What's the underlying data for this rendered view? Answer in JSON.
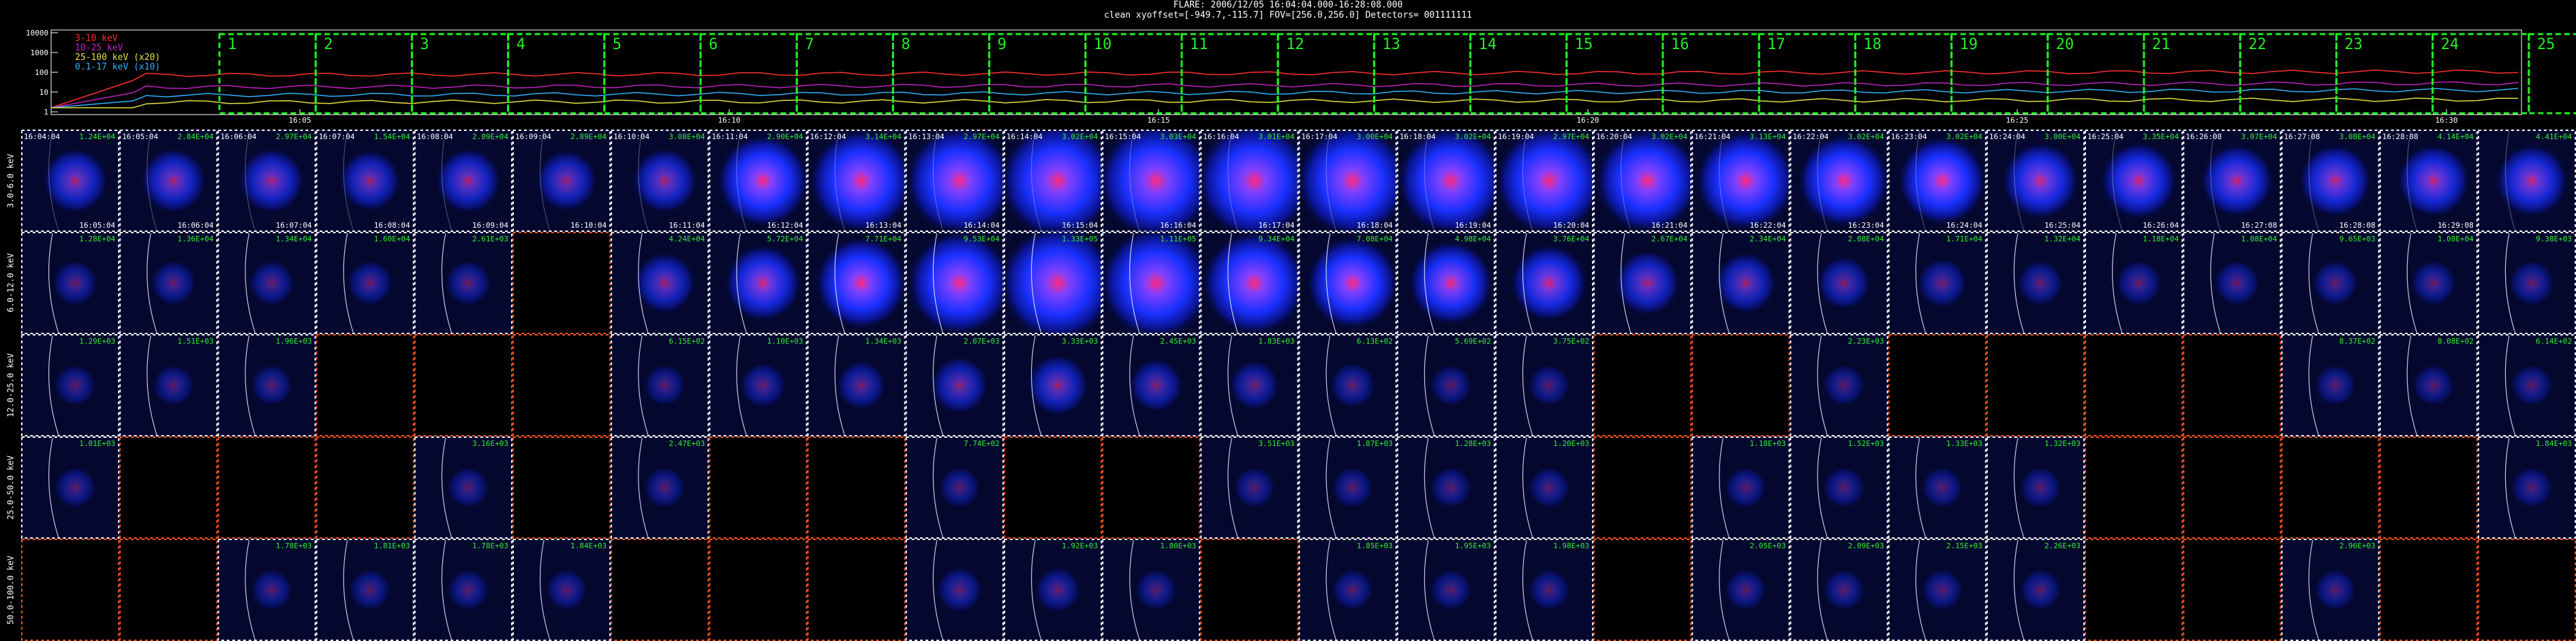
{
  "header": {
    "line1": "FLARE: 2006/12/05 16:04:04.000-16:28:08.000",
    "line2": "clean    xyoffset=[-949.7,-115.7]    FOV=[256.0,256.0]    Detectors= 001111111"
  },
  "lightcurve": {
    "y_ticks": [
      "10000",
      "1000",
      "100",
      "10",
      "1"
    ],
    "x_ticks": [
      "16:05",
      "16:10",
      "16:15",
      "16:20",
      "16:25",
      "16:30"
    ],
    "legend": [
      {
        "label": "3-10 keV",
        "color": "#ff3030"
      },
      {
        "label": "10-25 keV",
        "color": "#c020c0"
      },
      {
        "label": "25-100 keV (x20)",
        "color": "#e0e040"
      },
      {
        "label": "0.1-17 keV (x10)",
        "color": "#30b0ff"
      }
    ],
    "intervals": [
      "1",
      "2",
      "3",
      "4",
      "5",
      "6",
      "7",
      "8",
      "9",
      "10",
      "11",
      "12",
      "13",
      "14",
      "15",
      "16",
      "17",
      "18",
      "19",
      "20",
      "21",
      "22",
      "23",
      "24",
      "25"
    ],
    "colors": {
      "box": "#22ee22",
      "grid_ok": "#ffffff",
      "grid_bad": "#ff5522"
    }
  },
  "grid": {
    "rows": [
      {
        "energy": "3.0-6.0 keV",
        "labels": [
          "1.24E+04",
          "2.84E+04",
          "2.97E+04",
          "1.54E+04",
          "2.09E+04",
          "2.89E+04",
          "3.08E+04",
          "2.90E+04",
          "3.14E+04",
          "2.97E+04",
          "3.02E+04",
          "3.03E+04",
          "3.01E+04",
          "3.00E+04",
          "3.02E+04",
          "2.97E+04",
          "3.02E+04",
          "3.13E+04",
          "3.02E+04",
          "3.02E+04",
          "3.00E+04",
          "3.35E+04",
          "3.07E+04",
          "3.08E+04",
          "4.14E+04",
          "4.41E+04"
        ],
        "start_times": [
          "16:04:04",
          "16:05:04",
          "16:06:04",
          "16:07:04",
          "16:08:04",
          "16:09:04",
          "16:10:04",
          "16:11:04",
          "16:12:04",
          "16:13:04",
          "16:14:04",
          "16:15:04",
          "16:16:04",
          "16:17:04",
          "16:18:04",
          "16:19:04",
          "16:20:04",
          "16:21:04",
          "16:22:04",
          "16:23:04",
          "16:24:04",
          "16:25:04",
          "16:26:08",
          "16:27:08",
          "16:28:08"
        ],
        "end_times": [
          "16:05:04",
          "16:06:04",
          "16:07:04",
          "16:08:04",
          "16:09:04",
          "16:10:04",
          "16:11:04",
          "16:12:04",
          "16:13:04",
          "16:14:04",
          "16:15:04",
          "16:16:04",
          "16:17:04",
          "16:18:04",
          "16:19:04",
          "16:20:04",
          "16:21:04",
          "16:22:04",
          "16:23:04",
          "16:24:04",
          "16:25:04",
          "16:26:04",
          "16:27:08",
          "16:28:08",
          "16:29:08"
        ],
        "missing": [],
        "intensity": [
          0.35,
          0.35,
          0.35,
          0.3,
          0.35,
          0.3,
          0.35,
          0.7,
          0.85,
          0.9,
          1.0,
          1.0,
          1.0,
          0.95,
          0.9,
          0.9,
          0.85,
          0.8,
          0.7,
          0.65,
          0.5,
          0.5,
          0.45,
          0.45,
          0.45,
          0.45
        ]
      },
      {
        "energy": "6.0-12.0 keV",
        "labels": [
          "1.28E+04",
          "1.36E+04",
          "1.34E+04",
          "1.60E+04",
          "2.61E+03",
          "",
          "4.24E+04",
          "5.72E+04",
          "7.71E+04",
          "9.53E+04",
          "1.33E+05",
          "1.11E+05",
          "9.34E+04",
          "7.08E+04",
          "4.98E+04",
          "3.76E+04",
          "2.67E+04",
          "2.34E+04",
          "2.08E+04",
          "1.71E+04",
          "1.32E+04",
          "1.18E+04",
          "1.08E+04",
          "9.65E+03",
          "1.08E+04",
          "9.38E+03"
        ],
        "missing": [
          5
        ],
        "intensity": [
          0.1,
          0.1,
          0.1,
          0.1,
          0.1,
          0,
          0.3,
          0.5,
          0.7,
          0.85,
          1.0,
          0.95,
          0.85,
          0.7,
          0.6,
          0.5,
          0.35,
          0.3,
          0.2,
          0.15,
          0.1,
          0.1,
          0.1,
          0.1,
          0.1,
          0.1
        ]
      },
      {
        "energy": "12.0-25.0 keV",
        "labels": [
          "1.29E+03",
          "1.51E+03",
          "1.96E+03",
          "",
          "",
          "",
          "6.15E+02",
          "1.10E+03",
          "1.34E+03",
          "2.07E+03",
          "3.33E+03",
          "2.45E+03",
          "1.83E+03",
          "6.13E+02",
          "5.69E+02",
          "3.75E+02",
          "",
          "",
          "2.23E+03",
          "",
          "",
          "",
          "",
          "8.37E+02",
          "8.08E+02",
          "6.14E+02"
        ],
        "missing": [
          3,
          4,
          5,
          16,
          17,
          19,
          20,
          21,
          22
        ],
        "intensity": [
          0.05,
          0.05,
          0.05,
          0,
          0,
          0,
          0.05,
          0.1,
          0.15,
          0.25,
          0.3,
          0.2,
          0.15,
          0.1,
          0.05,
          0.05,
          0,
          0,
          0.05,
          0,
          0,
          0,
          0,
          0.05,
          0.05,
          0.05
        ]
      },
      {
        "energy": "25.0-50.0 keV",
        "labels": [
          "1.01E+03",
          "",
          "",
          "",
          "3.16E+03",
          "",
          "2.47E+03",
          "",
          "",
          "7.74E+02",
          "",
          "",
          "3.51E+03",
          "1.87E+03",
          "1.28E+03",
          "1.20E+03",
          "",
          "1.18E+03",
          "1.52E+03",
          "1.33E+03",
          "1.32E+03",
          "",
          "",
          "",
          "",
          "1.84E+03"
        ],
        "missing": [
          1,
          2,
          3,
          5,
          7,
          8,
          10,
          11,
          16,
          21,
          22,
          23,
          24
        ],
        "intensity": [
          0.05,
          0,
          0,
          0,
          0.05,
          0,
          0.05,
          0,
          0,
          0.05,
          0,
          0,
          0.05,
          0.05,
          0.05,
          0.05,
          0,
          0.05,
          0.05,
          0.05,
          0.05,
          0,
          0,
          0,
          0,
          0.05
        ]
      },
      {
        "energy": "50.0-100.0 keV",
        "labels": [
          "",
          "",
          "1.78E+03",
          "1.81E+03",
          "1.78E+03",
          "1.84E+03",
          "",
          "",
          "",
          "",
          "1.92E+03",
          "1.80E+03",
          "",
          "1.85E+03",
          "1.95E+03",
          "1.98E+03",
          "",
          "2.05E+03",
          "2.09E+03",
          "2.15E+03",
          "2.26E+03",
          "",
          "",
          "2.96E+03",
          "",
          "",
          ""
        ],
        "missing": [
          0,
          1,
          6,
          7,
          8,
          12,
          16,
          21,
          22,
          24,
          25
        ],
        "intensity": [
          0,
          0,
          0.05,
          0.05,
          0.05,
          0.05,
          0,
          0,
          0,
          0.1,
          0.1,
          0.05,
          0,
          0.05,
          0.05,
          0.05,
          0,
          0.05,
          0.05,
          0.05,
          0.05,
          0,
          0,
          0.05,
          0,
          0
        ]
      }
    ]
  }
}
